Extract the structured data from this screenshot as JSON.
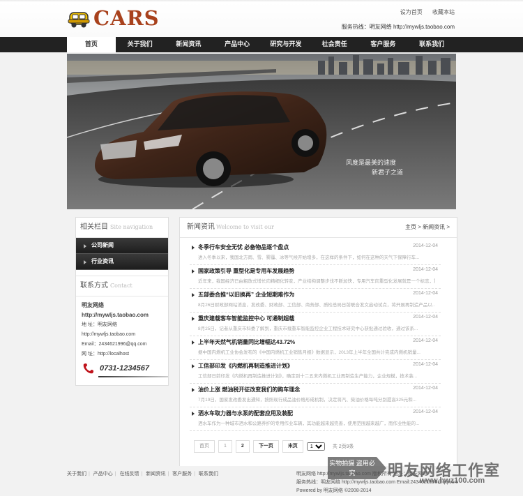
{
  "header": {
    "logo_text": "CARS",
    "links": [
      "设为首页",
      "收藏本站"
    ],
    "hotline": "服务热线：明友网络 http://mywljs.taobao.com"
  },
  "nav": {
    "items": [
      "首页",
      "关于我们",
      "新闻资讯",
      "产品中心",
      "研究与开发",
      "社会责任",
      "客户服务",
      "联系我们"
    ]
  },
  "banner": {
    "caption1": "风度是最美的速度",
    "caption2": "新君子之道"
  },
  "sidebar": {
    "title": "相关栏目",
    "title_en": "Site navigation",
    "categories": [
      "公司新闻",
      "行业资讯"
    ],
    "contact_title": "联系方式",
    "contact_title_en": "Contact",
    "contact": {
      "company": "明友网络",
      "url": "http://mywljs.taobao.com",
      "address": "地 址：明友网络",
      "address_url": "http://mywljs.taobao.com",
      "email": "Email：2434621996@qq.com",
      "site": "网 址：http://localhost",
      "phone": "0731-1234567"
    }
  },
  "main": {
    "title": "新闻资讯",
    "title_en": "Welcome to visit our",
    "breadcrumb": "主页 > 新闻资讯 >",
    "news": [
      {
        "title": "冬季行车安全无忧 必备物品逐个盘点",
        "date": "2014-12-04",
        "summary": "进入冬季以来，我国北方雨、雪、雾霾、冰等气候开始增多，在这样的条件下，如何在这种的天气下保障行车..."
      },
      {
        "title": "国家政策引导 重型化是专用车发展趋势",
        "date": "2014-12-04",
        "summary": "近年来，我国经济已由粗放式增长向精细化转变，产业结构调整步伐不断加快，专用汽车向重型化发展就是一个标志，重型专用汽车..."
      },
      {
        "title": "五部委合推“以旧换再” 企业短期难作为",
        "date": "2014-12-04",
        "summary": "8月26日财政部网站消息，发改委、财政部、工信部、商务部、质检总局日前联合发文启动试点，将开展再制造产品以..."
      },
      {
        "title": "重庆建载客车智能监控中心 可通制超载",
        "date": "2014-12-04",
        "summary": "8月25日，记者从重庆市科委了解到，重庆市载重车智能监控企业工程技术研究中心获批通过验收，通过该系..."
      },
      {
        "title": "上半年天然气机销量同比增幅达43.72%",
        "date": "2014-12-04",
        "summary": "据中国内燃机工业协会发布的《中国内燃机工业销售月报》数据显示，2013年上半年全国共计完成内燃机销量..."
      },
      {
        "title": "工信部印发《内燃机再制造推进计划》",
        "date": "2014-12-04",
        "summary": "工信部日前印发《内燃机再制造推进计划》，确定到十二五末内燃机工业再制造生产能力，企业规模，技术装..."
      },
      {
        "title": "油价上涨 燃油税开征改变我们的购车理念",
        "date": "2014-12-04",
        "summary": "7月19日，国家发改委发出通知，按照现行成品油价格形成机制，决定将汽、柴油价格每吨分别提高325元和..."
      },
      {
        "title": "洒水车取力器与水泵的配套应用及装配",
        "date": "2014-12-04",
        "summary": "洒水车作为一种城市洒水和公路养护的专用作业车辆，其功能越来越完善，使用范围越来越广，而作业性能的..."
      }
    ],
    "pager": {
      "first": "首页",
      "page1": "1",
      "page2": "2",
      "next": "下一页",
      "last": "末页",
      "select": "1",
      "total": "共 2页9条"
    }
  },
  "footer": {
    "links": [
      "关于我们",
      "产品中心",
      "在线反馈",
      "新闻资讯",
      "客户服务",
      "联系我们"
    ],
    "line1": "明友网络 http://mywljs.taobao.com 版权所有 地址：明友网络",
    "line2": "服务热线：明友网络 http://mywljs.taobao.com Email:2434621996@qq.com",
    "line3": "Powered by 明友网络 ©2008-2014"
  },
  "watermark": {
    "box": "实物拍摄 盗用必究",
    "text": "明友网络工作室",
    "url": "www.hwz100.com"
  },
  "colors": {
    "logo": "#a8411c",
    "nav_bg": "#222222"
  }
}
